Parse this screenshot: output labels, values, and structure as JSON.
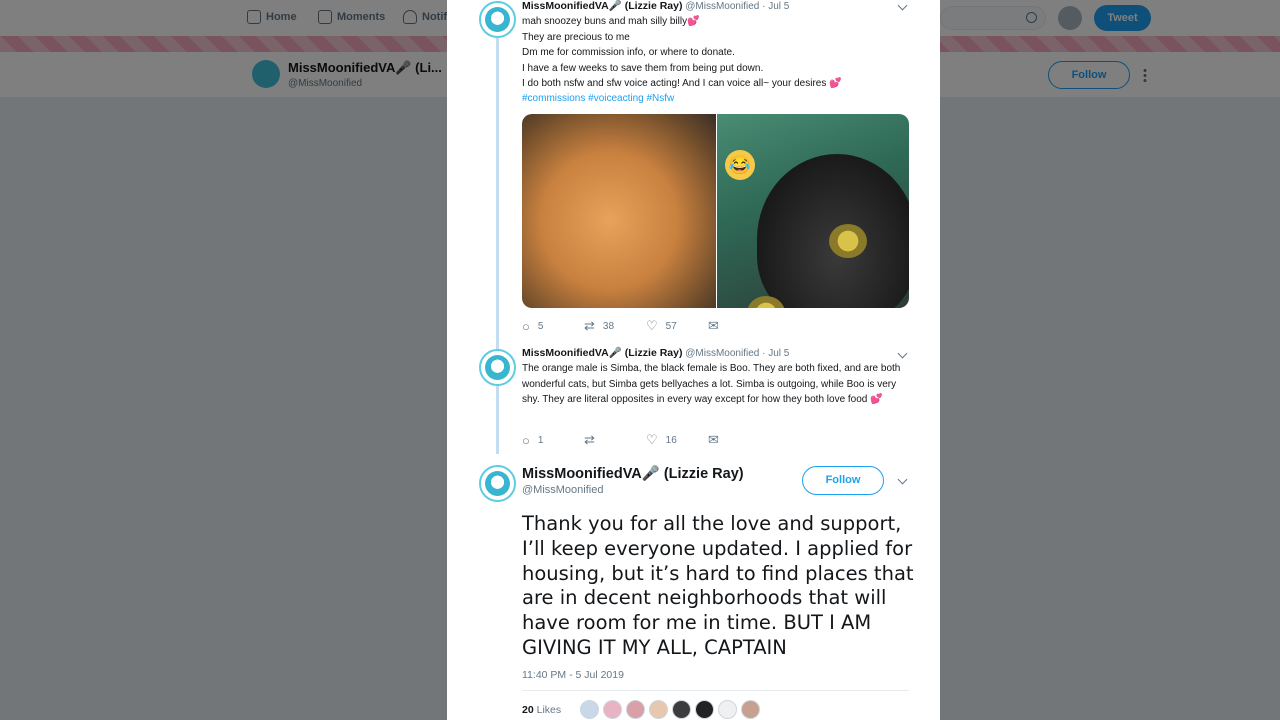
{
  "background": {
    "nav": {
      "home": "Home",
      "moments": "Moments",
      "notifications": "Notif"
    },
    "tweet_button": "Tweet",
    "profile": {
      "name": "MissMoonifiedVA🎤 (Li...",
      "handle": "@MissMoonified",
      "follow": "Follow"
    }
  },
  "thread": [
    {
      "name": "MissMoonifiedVA🎤 (Lizzie Ray)",
      "handle": "@MissMoonified · Jul 5",
      "lines": [
        "mah snoozey buns and mah silly billy",
        "They are precious to me",
        "Dm me for commission info, or where to donate.",
        "I have a few weeks to save them from being put down.",
        "I do both nsfw and sfw voice acting! And I can voice all~ your desires"
      ],
      "tags": "#commissions #voiceacting #Nsfw",
      "emoji_badge": "😂",
      "replies": "5",
      "retweets": "38",
      "likes": "57"
    },
    {
      "name": "MissMoonifiedVA🎤 (Lizzie Ray)",
      "handle": "@MissMoonified · Jul 5",
      "text": "The orange male is Simba, the black female is Boo. They are both fixed, and are both wonderful cats, but Simba gets bellyaches a lot. Simba is outgoing, while Boo is very shy. They are literal opposites in every way except for how they both love food",
      "replies": "1",
      "retweets": "",
      "likes": "16"
    }
  ],
  "main_tweet": {
    "name": "MissMoonifiedVA🎤 (Lizzie Ray)",
    "handle": "@MissMoonified",
    "follow": "Follow",
    "text": "Thank you for all the love and support, I’ll keep everyone updated. I applied for housing, but it’s hard to find places that are in decent neighborhoods that will have room for me in time. BUT I AM GIVING IT MY ALL, CAPTAIN",
    "timestamp": "11:40 PM - 5 Jul 2019",
    "like_count": "20",
    "like_label": "Likes"
  },
  "icons": {
    "heart_emoji": "💕",
    "reply": "reply-icon",
    "retweet": "retweet-icon",
    "like": "heart-icon",
    "dm": "envelope-icon"
  },
  "colors": {
    "accent": "#1da1f2",
    "thread_line": "#c4ddf0",
    "avatar_ring": "#5ccde0"
  }
}
